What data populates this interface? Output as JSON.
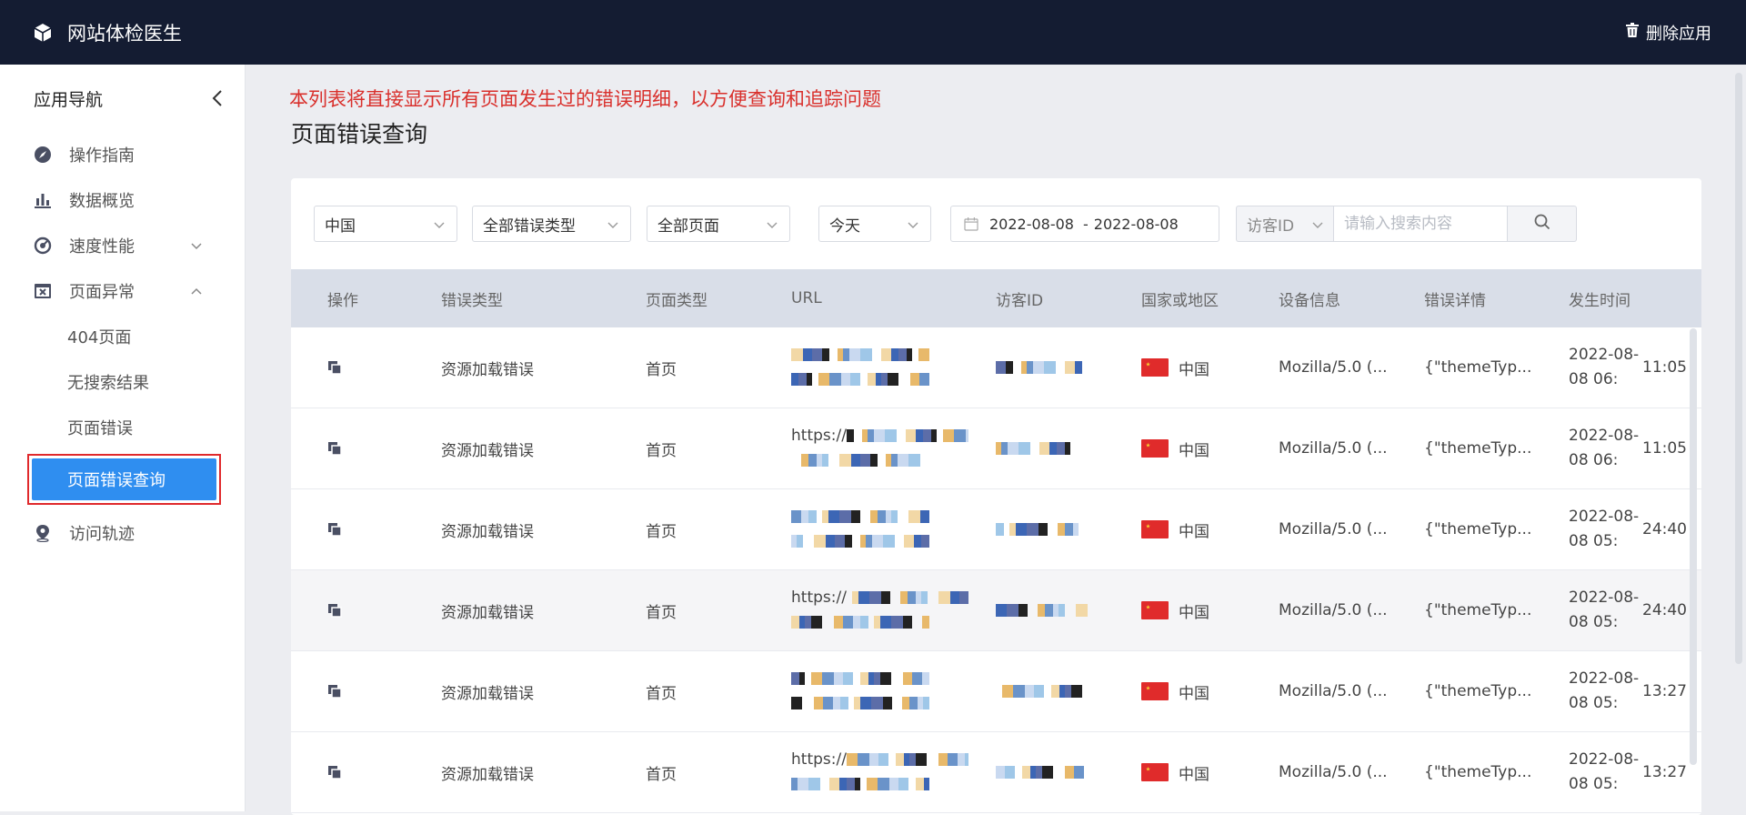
{
  "app": {
    "title": "网站体检医生",
    "delete_label": "删除应用"
  },
  "sidebar": {
    "heading": "应用导航",
    "items": [
      {
        "label": "操作指南",
        "icon": "compass-icon"
      },
      {
        "label": "数据概览",
        "icon": "bar-chart-icon"
      },
      {
        "label": "速度性能",
        "icon": "gauge-icon",
        "expand": "chevron-down-icon"
      },
      {
        "label": "页面异常",
        "icon": "browser-error-icon",
        "expand": "chevron-up-icon"
      }
    ],
    "subitems": [
      "404页面",
      "无搜索结果",
      "页面错误"
    ],
    "active_subitem": "页面错误查询",
    "last_item": {
      "label": "访问轨迹",
      "icon": "location-pin-icon"
    }
  },
  "main": {
    "notice": "本列表将直接显示所有页面发生过的错误明细，以方便查询和追踪问题",
    "title": "页面错误查询"
  },
  "filters": {
    "region": "中国",
    "error_type": "全部错误类型",
    "page": "全部页面",
    "period": "今天",
    "date_start": "2022-08-08",
    "date_sep": "-",
    "date_end": "2022-08-08",
    "search_type": "访客ID",
    "search_placeholder": "请输入搜索内容"
  },
  "table": {
    "columns": [
      "操作",
      "错误类型",
      "页面类型",
      "URL",
      "访客ID",
      "国家或地区",
      "设备信息",
      "错误详情",
      "发生时间"
    ],
    "rows": [
      {
        "error_type": "资源加载错误",
        "page_type": "首页",
        "url1": "",
        "url2": "",
        "visitor": "",
        "country": "中国",
        "device": "Mozilla/5.0 (...",
        "detail": "{\"themeTyp...",
        "time1": "2022-08-08 06:",
        "time2": "11:05"
      },
      {
        "error_type": "资源加载错误",
        "page_type": "首页",
        "url1": "https://",
        "url2": "",
        "visitor": "",
        "country": "中国",
        "device": "Mozilla/5.0 (...",
        "detail": "{\"themeTyp...",
        "time1": "2022-08-08 06:",
        "time2": "11:05"
      },
      {
        "error_type": "资源加载错误",
        "page_type": "首页",
        "url1": "",
        "url2": "",
        "visitor": "",
        "country": "中国",
        "device": "Mozilla/5.0 (...",
        "detail": "{\"themeTyp...",
        "time1": "2022-08-08 05:",
        "time2": "24:40"
      },
      {
        "error_type": "资源加载错误",
        "page_type": "首页",
        "url1": "https://",
        "url2": "",
        "visitor": "",
        "country": "中国",
        "device": "Mozilla/5.0 (...",
        "detail": "{\"themeTyp...",
        "time1": "2022-08-08 05:",
        "time2": "24:40"
      },
      {
        "error_type": "资源加载错误",
        "page_type": "首页",
        "url1": "",
        "url2": "",
        "visitor": "",
        "country": "中国",
        "device": "Mozilla/5.0 (...",
        "detail": "{\"themeTyp...",
        "time1": "2022-08-08 05:",
        "time2": "13:27"
      },
      {
        "error_type": "资源加载错误",
        "page_type": "首页",
        "url1": "https://",
        "url2": "",
        "visitor": "",
        "country": "中国",
        "device": "Mozilla/5.0 (...",
        "detail": "{\"themeTyp...",
        "time1": "2022-08-08 05:",
        "time2": "13:27"
      }
    ]
  },
  "colors": {
    "topbar": "#141c32",
    "accent": "#2f8ef0",
    "notice": "#d9302c",
    "highlight_box": "#e0292c"
  }
}
